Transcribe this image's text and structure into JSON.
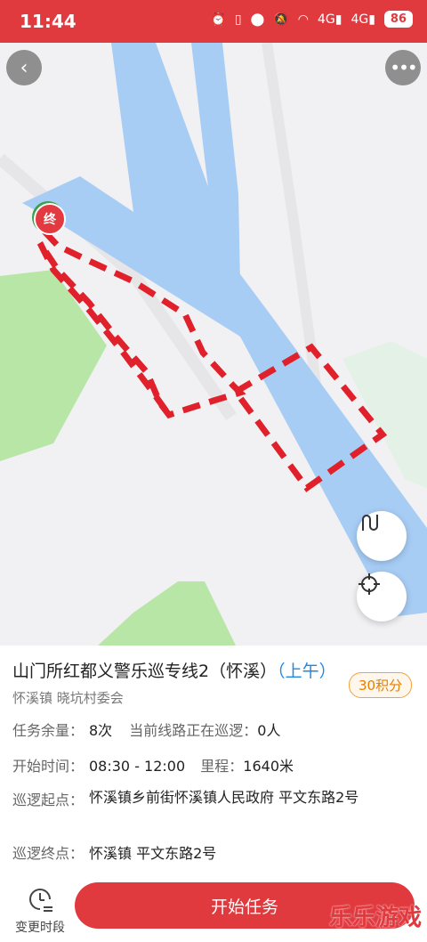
{
  "status_bar": {
    "time": "11:44",
    "battery": "86",
    "icons": [
      "alarm-icon",
      "battery-saver-icon",
      "location-icon",
      "mute-icon",
      "wifi-icon",
      "signal-4g-icon",
      "signal-4g-icon"
    ]
  },
  "map": {
    "end_marker": "终",
    "colors": {
      "river": "#a7cdf5",
      "grass": "#b7e6a7",
      "route": "#e0202a",
      "land": "#f1f1f3"
    }
  },
  "task": {
    "title": "山门所红都义警乐巡专线2（怀溪）",
    "title_suffix": "（上午）",
    "points_badge": "30积分",
    "subtitle": "怀溪镇 晓坑村委会",
    "remaining_label": "任务余量：",
    "remaining_value": "8次",
    "current_label": "当前线路正在巡逻：",
    "current_value": "0人",
    "time_label": "开始时间：",
    "time_value": "08:30 - 12:00",
    "distance_label": "里程：",
    "distance_value": "1640米",
    "start_label": "巡逻起点：",
    "start_value": "怀溪镇乡前街怀溪镇人民政府 平文东路2号",
    "end_label": "巡逻终点：",
    "end_value": "怀溪镇 平文东路2号"
  },
  "bottom": {
    "change_time_label": "变更时段",
    "start_button": "开始任务"
  },
  "watermark": "乐乐游戏"
}
